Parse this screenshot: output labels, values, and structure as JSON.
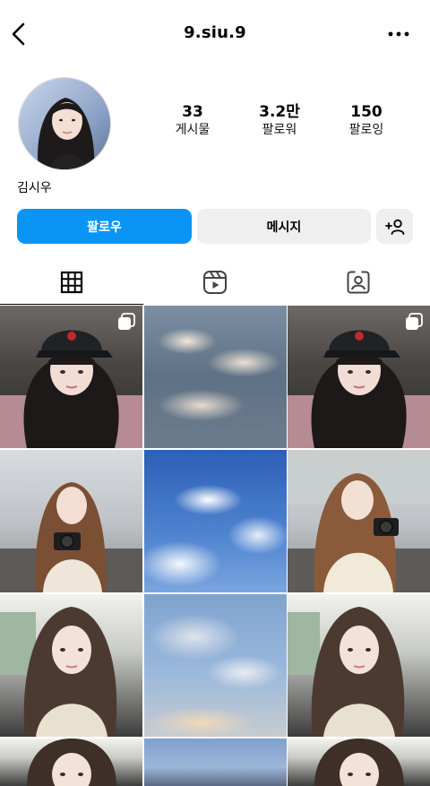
{
  "header": {
    "username": "9.siu.9",
    "back_icon": "chevron-left-icon",
    "more_icon": "ellipsis-icon"
  },
  "profile": {
    "display_name": "김시우",
    "stats": [
      {
        "value": "33",
        "label": "게시물"
      },
      {
        "value": "3.2만",
        "label": "팔로워"
      },
      {
        "value": "150",
        "label": "팔로잉"
      }
    ]
  },
  "actions": {
    "follow_label": "팔로우",
    "message_label": "메시지",
    "suggest_icon": "add-person-icon",
    "follow_color": "#0a95f6"
  },
  "tabs": [
    {
      "name": "posts",
      "icon": "grid-icon",
      "active": true
    },
    {
      "name": "reels",
      "icon": "reels-icon",
      "active": false
    },
    {
      "name": "tagged",
      "icon": "tagged-icon",
      "active": false
    }
  ],
  "grid": {
    "tiles": [
      {
        "kind": "photo",
        "subject": "girl in black cap",
        "multi": true
      },
      {
        "kind": "photo",
        "subject": "cloudy sky",
        "multi": false
      },
      {
        "kind": "photo",
        "subject": "girl in black cap",
        "multi": true
      },
      {
        "kind": "photo",
        "subject": "girl with camera",
        "multi": false
      },
      {
        "kind": "photo",
        "subject": "blue sky with clouds",
        "multi": false
      },
      {
        "kind": "photo",
        "subject": "girl with camera",
        "multi": false
      },
      {
        "kind": "photo",
        "subject": "girl in car",
        "multi": false
      },
      {
        "kind": "photo",
        "subject": "sky with clouds",
        "multi": false
      },
      {
        "kind": "photo",
        "subject": "girl in car",
        "multi": false
      },
      {
        "kind": "photo",
        "subject": "girl portrait",
        "multi": false
      },
      {
        "kind": "photo",
        "subject": "sky",
        "multi": false
      },
      {
        "kind": "photo",
        "subject": "girl portrait",
        "multi": false
      }
    ]
  }
}
